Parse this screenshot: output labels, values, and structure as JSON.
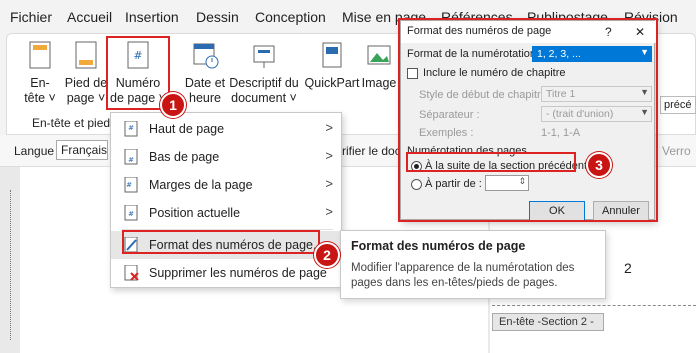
{
  "menubar": {
    "items": [
      "Fichier",
      "Accueil",
      "Insertion",
      "Dessin",
      "Conception",
      "Mise en page",
      "Références",
      "Publipostage",
      "Révision"
    ]
  },
  "ribbon": {
    "buttons": [
      {
        "label1": "En-",
        "label2": "tête ˅"
      },
      {
        "label1": "Pied de",
        "label2": "page ˅"
      },
      {
        "label1": "Numéro",
        "label2": "de page ˅"
      },
      {
        "label1": "Date et",
        "label2": "heure"
      },
      {
        "label1": "Descriptif du",
        "label2": "document ˅"
      },
      {
        "label1": "QuickPart",
        "label2": ""
      },
      {
        "label1": "Image",
        "label2": ""
      }
    ],
    "group_label": "En-tête et pied",
    "right_fragment": "précé"
  },
  "bar2": {
    "langue_label": "Langue",
    "langue_value": "Français (",
    "verifier_fragment": "rifier le doc",
    "verr_fragment": "Verro"
  },
  "menu": {
    "items": [
      {
        "label": "Haut de page",
        "arrow": ">"
      },
      {
        "label": "Bas de page",
        "arrow": ">"
      },
      {
        "label": "Marges de la page",
        "arrow": ">"
      },
      {
        "label": "Position actuelle",
        "arrow": ">"
      },
      {
        "label": "Format des numéros de page...",
        "arrow": ""
      },
      {
        "label": "Supprimer les numéros de page",
        "arrow": ""
      }
    ]
  },
  "tooltip": {
    "title": "Format des numéros de page",
    "body": "Modifier l'apparence de la numérotation des pages dans les en-têtes/pieds de pages."
  },
  "dialog": {
    "title": "Format des numéros de page",
    "help": "?",
    "close": "✕",
    "format_label": "Format de la numérotation :",
    "format_value": "1, 2, 3, ...",
    "include_chapter": "Inclure le numéro de chapitre",
    "chapter_style_label": "Style de début de chapitre :",
    "chapter_style_value": "Titre 1",
    "separator_label": "Séparateur :",
    "separator_value": "-     (trait d'union)",
    "examples_label": "Exemples :",
    "examples_value": "1-1, 1-A",
    "section_label": "Numérotation des pages",
    "continue_label": "À la suite de la section précédente",
    "start_at_label": "À partir de :",
    "ok": "OK",
    "cancel": "Annuler"
  },
  "badges": [
    "1",
    "2",
    "3"
  ],
  "document": {
    "page_number": "2",
    "header_label": "En-tête -Section 2 -"
  },
  "colors": {
    "highlight_red": "#d22222",
    "badge_red": "#c91414",
    "selection_blue": "#0078d7"
  }
}
